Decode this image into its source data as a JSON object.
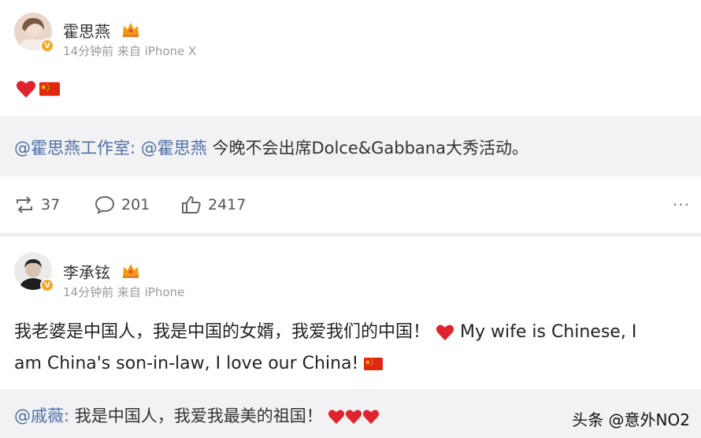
{
  "post1": {
    "username": "霍思燕",
    "meta": "14分钟前  来自 iPhone X",
    "badge": "V",
    "quote": {
      "mention1": "@霍思燕工作室:",
      "mention2": "@霍思燕",
      "text": " 今晚不会出席Dolce&Gabbana大秀活动。"
    },
    "actions": {
      "repost_count": "37",
      "comment_count": "201",
      "like_count": "2417",
      "more": "···"
    }
  },
  "post2": {
    "username": "李承铉",
    "meta": "14分钟前  来自 iPhone",
    "badge": "V",
    "body_line1": "我老婆是中国人，我是中国的女婿，我爱我们的中国！",
    "body_line1_en": " My wife is Chinese, I",
    "body_line2": "am China's son-in-law, I love our China! ",
    "quote": {
      "mention": "@戚薇:",
      "text": " 我是中国人，我爱我最美的祖国！"
    }
  },
  "watermark": "头条 @意外NO2",
  "colors": {
    "mention": "#4e6ea4",
    "heart": "#e0242f",
    "flag_red": "#de2910",
    "flag_star": "#ffde00",
    "quote_bg": "#f2f2f4",
    "badge": "#f6a623"
  },
  "icons": [
    "crown-icon",
    "heart-icon",
    "china-flag-icon",
    "repost-icon",
    "comment-icon",
    "like-icon",
    "more-icon"
  ]
}
